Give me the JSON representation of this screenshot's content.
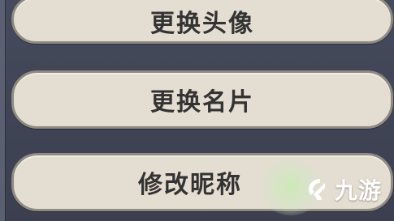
{
  "menu": {
    "items": [
      {
        "label": "更换头像"
      },
      {
        "label": "更换名片"
      },
      {
        "label": "修改昵称"
      }
    ]
  },
  "watermark": {
    "text": "九游",
    "icon": "jiuyou-logo-icon"
  },
  "colors": {
    "background": "#3f4354",
    "button_fill": "#e4ddd1",
    "button_border": "#8f8a82",
    "label_text": "#333333"
  }
}
